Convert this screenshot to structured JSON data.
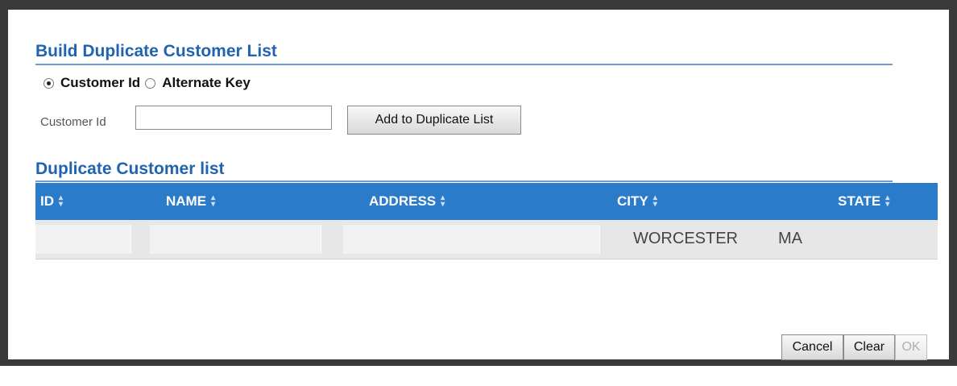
{
  "build_section": {
    "title": "Build Duplicate Customer List",
    "radio_options": [
      {
        "label": "Customer Id",
        "checked": true
      },
      {
        "label": "Alternate Key",
        "checked": false
      }
    ],
    "field_label": "Customer Id",
    "field_value": "",
    "add_button": "Add to Duplicate List"
  },
  "list_section": {
    "title": "Duplicate Customer list",
    "columns": [
      "ID",
      "NAME",
      "ADDRESS",
      "CITY",
      "STATE"
    ],
    "rows": [
      {
        "id": "",
        "name": "",
        "address": "",
        "city": "WORCESTER",
        "state": "MA"
      }
    ]
  },
  "footer": {
    "cancel_label": "Cancel",
    "clear_label": "Clear",
    "ok_label": "OK",
    "ok_enabled": false
  },
  "colors": {
    "accent": "#1f63b1",
    "header_bg": "#2b7bcb",
    "row_bg": "#e7e7e7"
  },
  "icons": {
    "sort": "sort-updown-icon",
    "radio_selected": "radio-selected-icon",
    "radio_unselected": "radio-unselected-icon"
  }
}
